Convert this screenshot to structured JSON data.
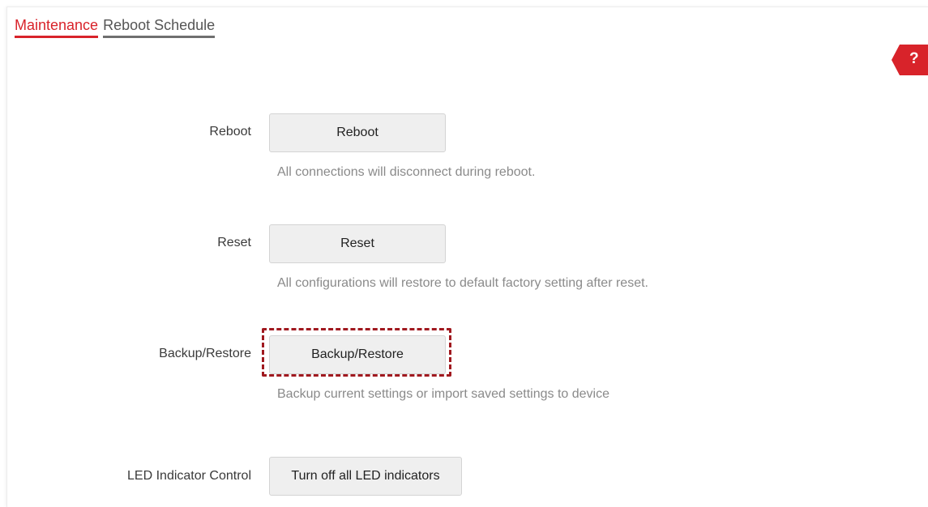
{
  "tabs": {
    "maintenance": "Maintenance",
    "reboot_schedule": "Reboot Schedule"
  },
  "help": {
    "symbol": "?",
    "icon": "help-icon"
  },
  "rows": {
    "reboot": {
      "label": "Reboot",
      "button": "Reboot",
      "hint": "All connections will disconnect during reboot."
    },
    "reset": {
      "label": "Reset",
      "button": "Reset",
      "hint": "All configurations will restore to default factory setting after reset."
    },
    "backup": {
      "label": "Backup/Restore",
      "button": "Backup/Restore",
      "hint": "Backup current settings or import saved settings to device"
    },
    "led": {
      "label": "LED Indicator Control",
      "button": "Turn off all LED indicators"
    }
  },
  "colors": {
    "accent": "#d8232a",
    "highlight": "#a0191f",
    "button_bg": "#efefef",
    "hint_text": "#8a8a8a"
  }
}
